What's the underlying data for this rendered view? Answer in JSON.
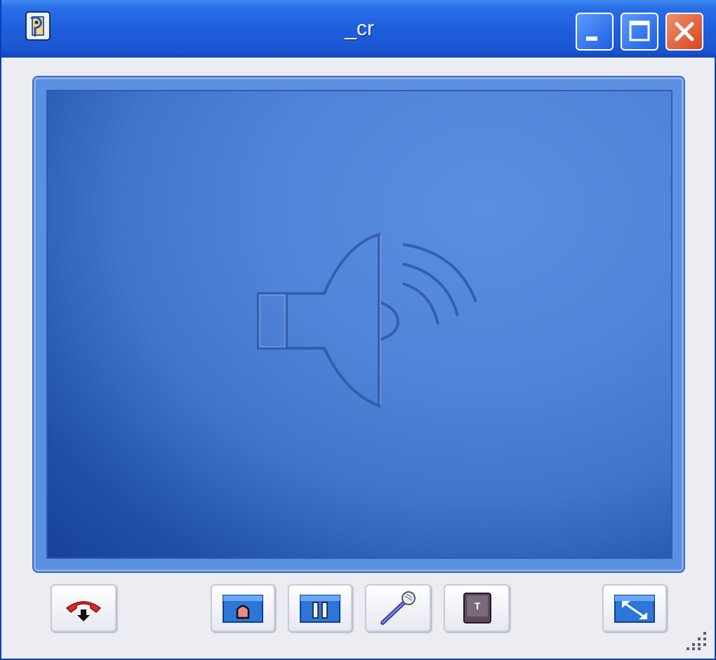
{
  "window": {
    "title": "_cr"
  },
  "title_buttons": {
    "minimize": "minimize-icon",
    "maximize": "maximize-icon",
    "close": "close-icon"
  },
  "main": {
    "icon": "speaker-volume-icon"
  },
  "controls": [
    {
      "name": "hang-up-button",
      "icon": "phone-hangup-icon"
    },
    {
      "name": "record-button",
      "icon": "record-icon"
    },
    {
      "name": "pause-button",
      "icon": "pause-icon"
    },
    {
      "name": "microphone-button",
      "icon": "microphone-icon"
    },
    {
      "name": "text-button",
      "icon": "text-key-icon",
      "label": "T"
    },
    {
      "name": "fullscreen-button",
      "icon": "resize-arrows-icon"
    }
  ],
  "colors": {
    "titlebar": "#1f5fdc",
    "viewport": "#4f84d8",
    "close": "#d9431c"
  }
}
